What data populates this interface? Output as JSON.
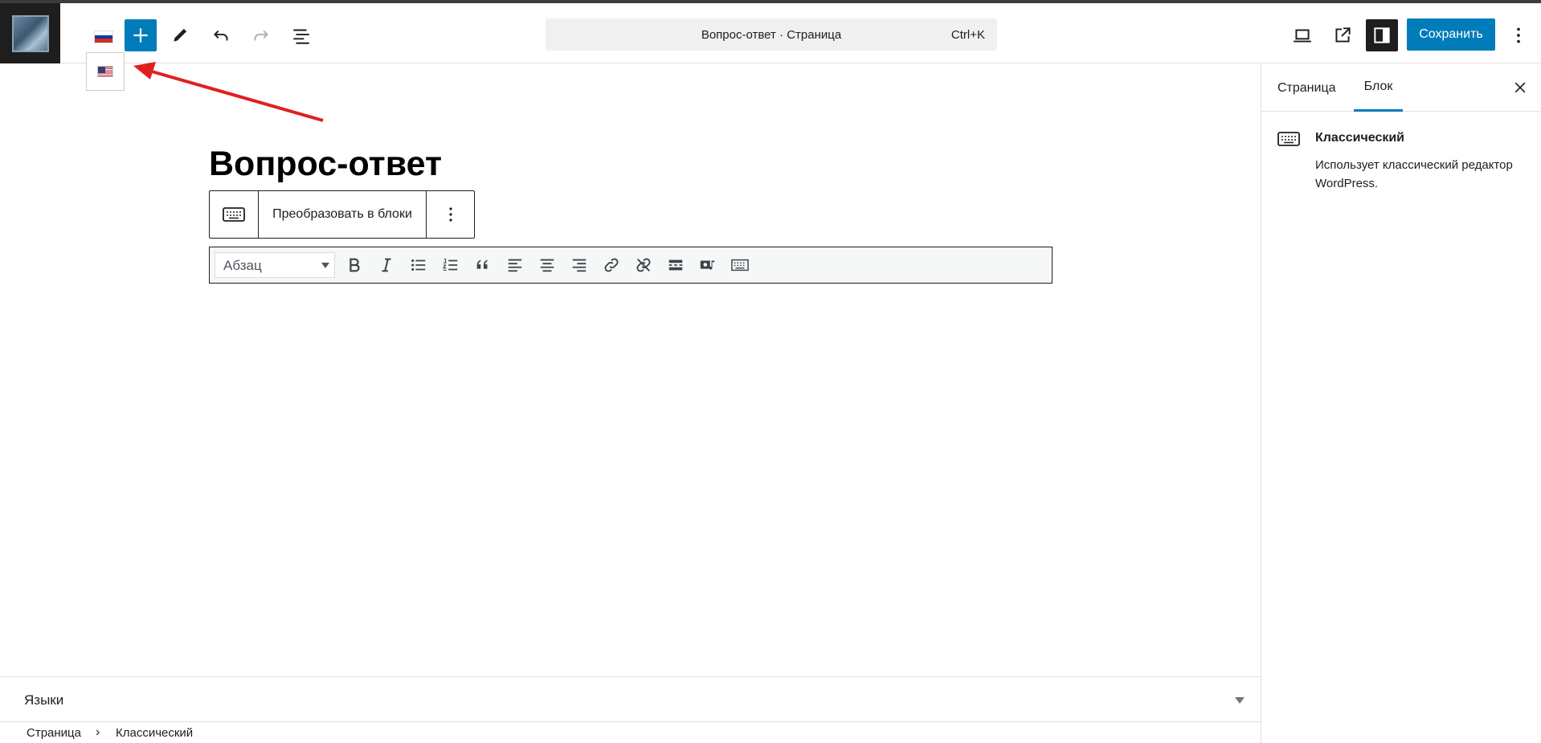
{
  "header": {
    "add_block_label": "+",
    "command_title": "Вопрос-ответ · Страница",
    "command_shortcut": "Ctrl+K",
    "save_label": "Сохранить"
  },
  "editor": {
    "page_title": "Вопрос-ответ",
    "block_toolbar": {
      "convert_label": "Преобразовать в блоки"
    },
    "classic_toolbar": {
      "format_value": "Абзац"
    }
  },
  "sidebar": {
    "tabs": [
      "Страница",
      "Блок"
    ],
    "active_tab": "Блок",
    "block_card": {
      "title": "Классический",
      "description": "Использует классический редактор WordPress."
    }
  },
  "languages_panel": {
    "label": "Языки"
  },
  "breadcrumb": {
    "items": [
      "Страница",
      "Классический"
    ],
    "separator": "›"
  },
  "colors": {
    "accent": "#007cba",
    "arrow": "#e0201f",
    "dark": "#1e1e1e"
  }
}
